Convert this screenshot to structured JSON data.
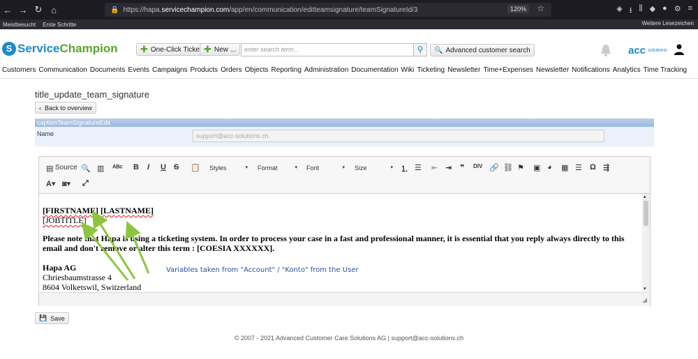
{
  "browser": {
    "url_prefix": "https://hapa.",
    "url_host": "servicechampion.com",
    "url_path": "/app/en/communication/editteamsignature/teamSignatureId/3",
    "zoom": "120%",
    "bookmarks": [
      "Meistbesucht",
      "Erste Schritte"
    ],
    "other_bookmarks": "Weitere Lesezeichen"
  },
  "header": {
    "logo_service": "Service",
    "logo_champion": "Champion",
    "one_click_ticket": "One-Click Ticket",
    "new": "New ...",
    "search_placeholder": "enter search term...",
    "advanced_search": "Advanced customer search",
    "acc_logo": "acc",
    "acc_solutions": "solutions"
  },
  "menu": [
    "Customers",
    "Communication",
    "Documents",
    "Events",
    "Campaigns",
    "Products",
    "Orders",
    "Objects",
    "Reporting",
    "Administration",
    "Documentation",
    "Wiki",
    "Ticketing",
    "Newsletter",
    "Time+Expenses",
    "Newsletter",
    "Notifications",
    "Analytics",
    "Time Tracking"
  ],
  "page": {
    "title": "title_update_team_signature",
    "back": "Back to overview",
    "caption": "captionTeamSignatureEdit",
    "name_label": "Name",
    "name_value": "support@acc-solutions.ch",
    "save": "Save"
  },
  "toolbar": {
    "source": "Source",
    "styles": "Styles",
    "format": "Format",
    "font": "Font",
    "size": "Size"
  },
  "content": {
    "firstname": "[FIRSTNAME]",
    "lastname": "[LASTNAME]",
    "jobtitle": "[JOBTITLE]",
    "para": "Please note that Hapa is using a ticketing system. In order to process your case in a fast and professional manner, it is essential that you reply always directly to this email and don't remove or alter this term : [COESIA XXXXXX].",
    "company": "Hapa AG",
    "street": "Chriesbaumstrasse 4",
    "city": "8604 Volketswil, Switzerland"
  },
  "annotation": "Variables taken from \"Account\" / \"Konto\" from the User",
  "footer": "© 2007 - 2021  Advanced Customer Care Solutions AG | support@acc-solutions.ch",
  "colors": {
    "brand_blue": "#1d8ac9",
    "brand_green": "#5aa52c",
    "arrow_green": "#8cc63f",
    "annotation_blue": "#2a4f9a"
  }
}
